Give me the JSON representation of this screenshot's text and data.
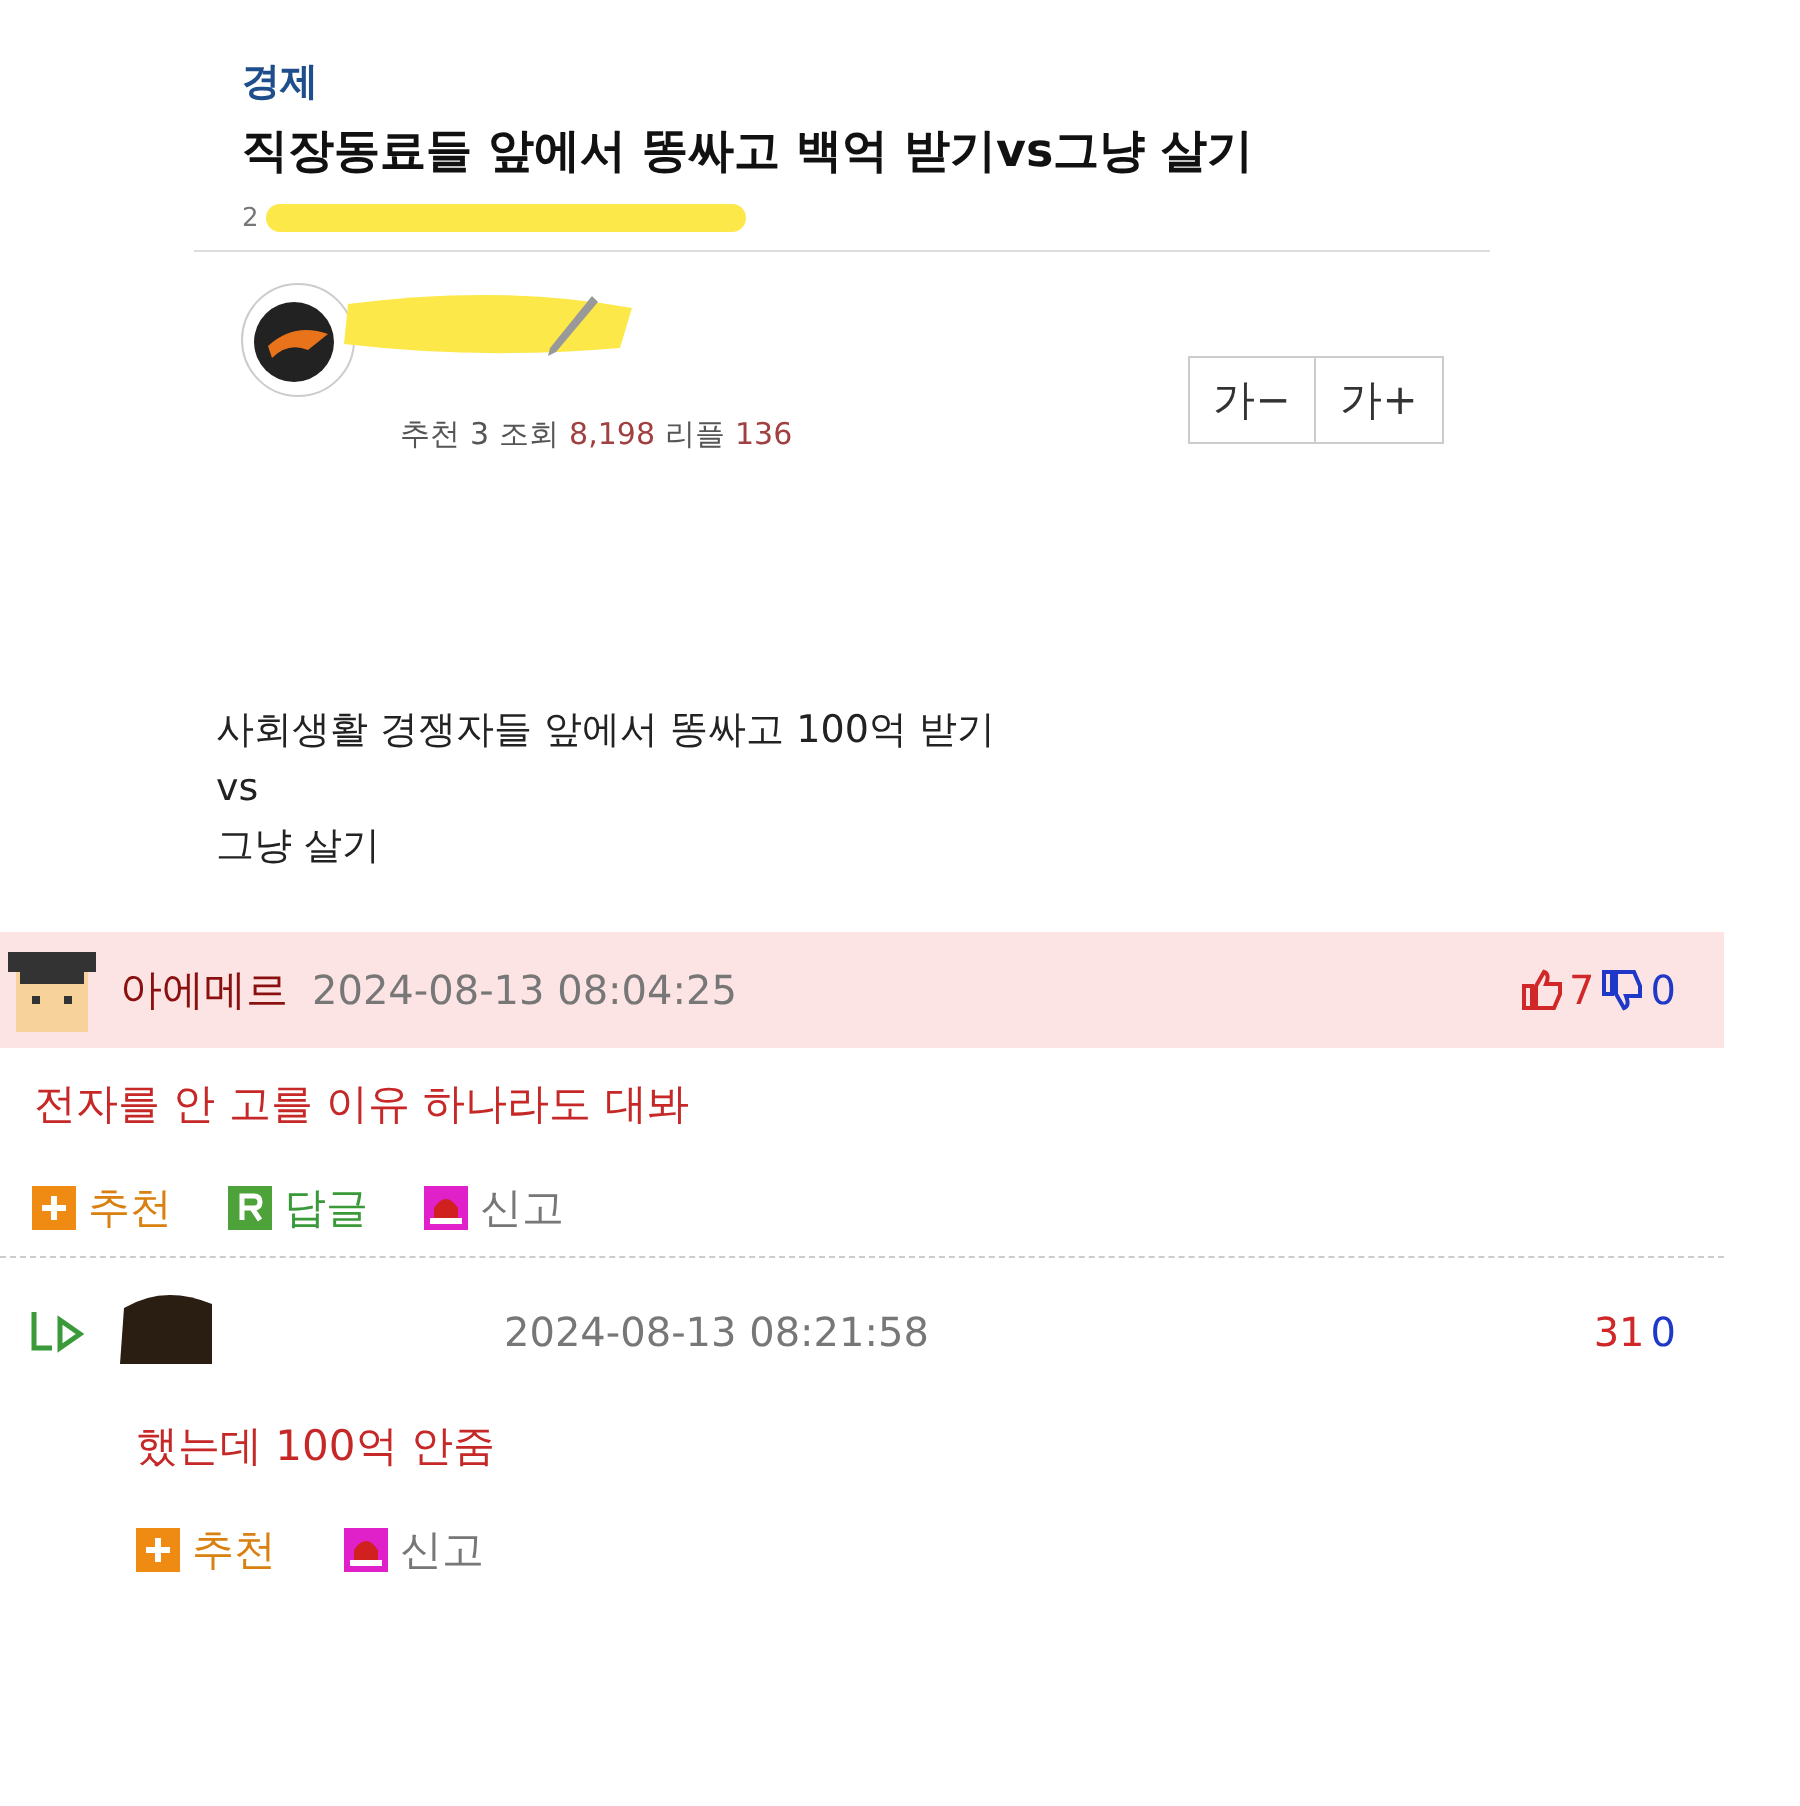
{
  "post": {
    "category": "경제",
    "title": "직장동료들 앞에서 똥싸고 백억 받기vs그냥 살기",
    "date": "2",
    "stats": [
      {
        "label": "추천",
        "value": "3",
        "kind": "plain"
      },
      {
        "label": "조회",
        "value": "8,198",
        "kind": "accent"
      },
      {
        "label": "리플",
        "value": "136",
        "kind": "accent"
      }
    ],
    "font_buttons": [
      "가−",
      "가+"
    ],
    "body": [
      "사회생활 경쟁자들 앞에서 똥싸고 100억 받기",
      "vs",
      "그냥 살기"
    ]
  },
  "comments": [
    {
      "kind": "top",
      "author": "아에메르",
      "time": "2024-08-13 08:04:25",
      "up": "7",
      "down": "0",
      "text": "전자를 안 고를 이유 하나라도 대봐",
      "actions": [
        {
          "kind": "recommend",
          "label": "추천"
        },
        {
          "kind": "reply",
          "label": "답글"
        },
        {
          "kind": "report",
          "label": "신고"
        }
      ]
    },
    {
      "kind": "reply",
      "time": "2024-08-13 08:21:58",
      "up": "31",
      "down": "0",
      "text": "했는데 100억 안줌",
      "actions": [
        {
          "kind": "recommend",
          "label": "추천"
        },
        {
          "kind": "report",
          "label": "신고"
        }
      ]
    }
  ]
}
